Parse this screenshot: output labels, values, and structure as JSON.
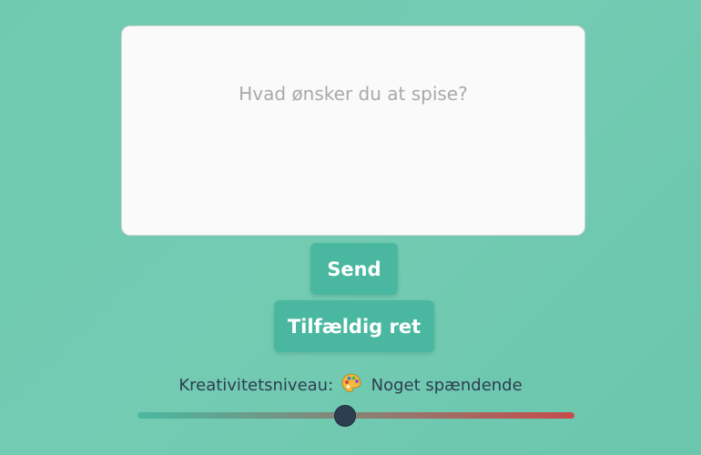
{
  "prompt": {
    "placeholder": "Hvad ønsker du at spise?",
    "value": ""
  },
  "buttons": {
    "send_label": "Send",
    "random_label": "Tilfældig ret"
  },
  "creativity": {
    "label": "Kreativitetsniveau:",
    "icon": "palette-icon",
    "level_text": "Noget spændende",
    "slider_value": 0.475,
    "gradient_start": "#4ab8a0",
    "gradient_end": "#c84b4b"
  },
  "colors": {
    "background": "#71cbb1",
    "button": "#4ab8a0",
    "text": "#2d3e50",
    "thumb": "#2c3e50"
  }
}
